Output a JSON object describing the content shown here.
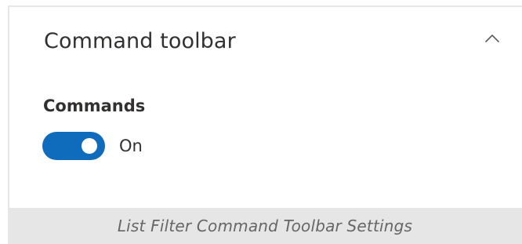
{
  "panel": {
    "section_title": "Command toolbar",
    "expanded": true,
    "commands_label": "Commands",
    "toggle": {
      "state": "On",
      "checked": true,
      "color": "#0f6cbd"
    },
    "collapse_icon": "chevron-up-icon"
  },
  "caption": {
    "text": "List Filter Command Toolbar Settings"
  }
}
